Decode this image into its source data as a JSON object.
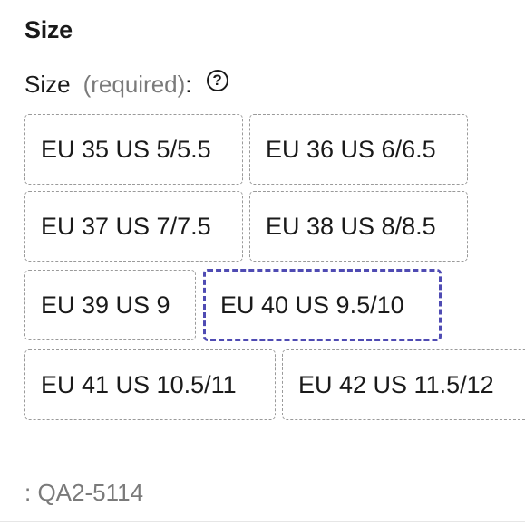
{
  "section": {
    "title": "Size"
  },
  "size_field": {
    "label": "Size",
    "required_text": "(required)",
    "colon": ":",
    "help_icon": "question-circle-icon",
    "help_glyph": "?"
  },
  "options": [
    {
      "label": "EU 35 US 5/5.5",
      "selected": false
    },
    {
      "label": "EU 36 US 6/6.5",
      "selected": false
    },
    {
      "label": "EU 37 US 7/7.5",
      "selected": false
    },
    {
      "label": "EU 38 US 8/8.5",
      "selected": false
    },
    {
      "label": "EU 39 US 9",
      "selected": false
    },
    {
      "label": "EU 40 US 9.5/10",
      "selected": true
    },
    {
      "label": "EU 41 US 10.5/11",
      "selected": false
    },
    {
      "label": "EU 42 US 11.5/12",
      "selected": false
    }
  ],
  "sku": {
    "text": ": QA2-5114"
  },
  "colors": {
    "selected_border": "#4f4bb3",
    "option_border": "#9a9a9a",
    "muted_text": "#7a7a7a"
  }
}
